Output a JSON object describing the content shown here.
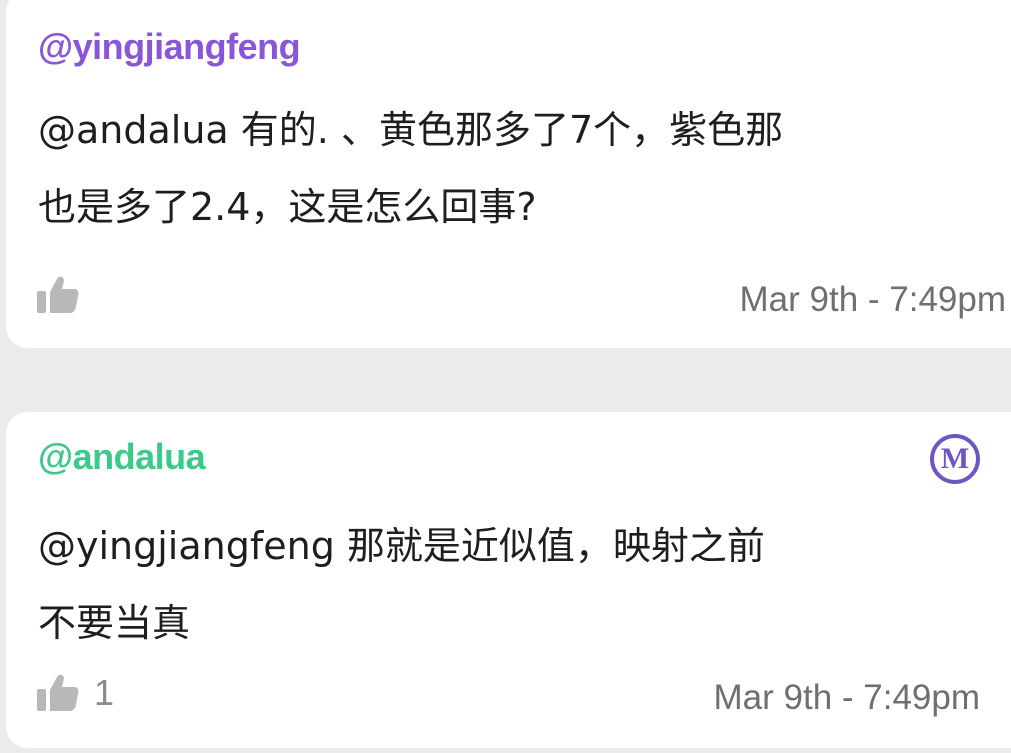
{
  "comments": [
    {
      "author": "@yingjiangfeng",
      "author_color": "#8a56d8",
      "body_lines": [
        "@andalua 有的. 、黄色那多了7个，紫色那",
        "也是多了2.4，这是怎么回事?"
      ],
      "like_icon": "thumbs-up-icon",
      "like_count": "",
      "timestamp": "Mar 9th - 7:49pm"
    },
    {
      "author": "@andalua",
      "author_color": "#3dc98a",
      "badge": "M",
      "badge_color": "#6e55c4",
      "body_lines": [
        "@yingjiangfeng 那就是近似值，映射之前",
        "不要当真"
      ],
      "like_icon": "thumbs-up-icon",
      "like_count": "1",
      "timestamp": "Mar 9th - 7:49pm"
    }
  ]
}
